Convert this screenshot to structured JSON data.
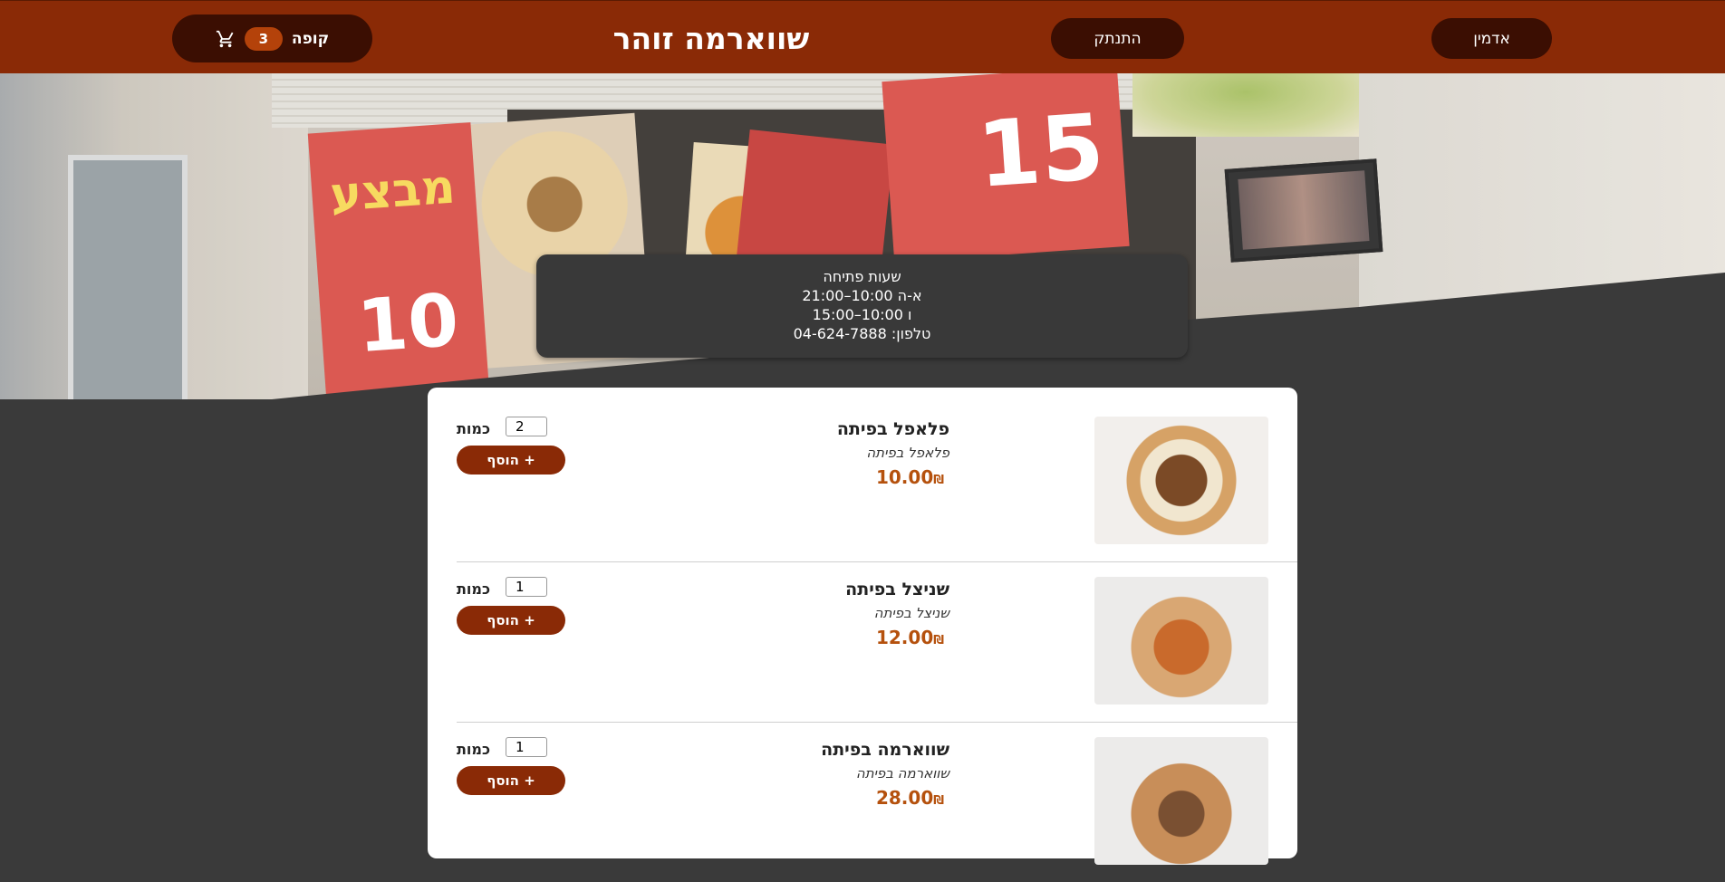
{
  "header": {
    "title": "שווארמה זוהר",
    "cart_label": "קופה",
    "cart_count": "3",
    "logout_label": "התנתק",
    "admin_label": "אדמין"
  },
  "hero": {
    "sign_text_1": "מבצע",
    "sign_number_1": "10",
    "sign_number_2": "15"
  },
  "hours": {
    "title": "שעות פתיחה",
    "line1": "א-ה 10:00–21:00",
    "line2": "ו 10:00–15:00",
    "phone": "טלפון: 04-624-7888"
  },
  "menu": {
    "quantity_label": "כמות",
    "add_label": "+ הוסף",
    "currency": "₪",
    "items": [
      {
        "name": "פלאפל בפיתה",
        "description": "פלאפל בפיתה",
        "price": "10.00",
        "quantity": "2",
        "image": "falafel-pita"
      },
      {
        "name": "שניצל בפיתה",
        "description": "שניצל בפיתה",
        "price": "12.00",
        "quantity": "1",
        "image": "schnitzel-pita"
      },
      {
        "name": "שווארמה בפיתה",
        "description": "שווארמה בפיתה",
        "price": "28.00",
        "quantity": "1",
        "image": "shawarma-pita"
      }
    ]
  },
  "colors": {
    "header_bg": "#8a2a06",
    "button_dark": "#3b0e02",
    "accent_price": "#b5510d",
    "page_bg": "#3a3a3a"
  },
  "icons": {
    "cart": "shopping-cart-icon"
  }
}
